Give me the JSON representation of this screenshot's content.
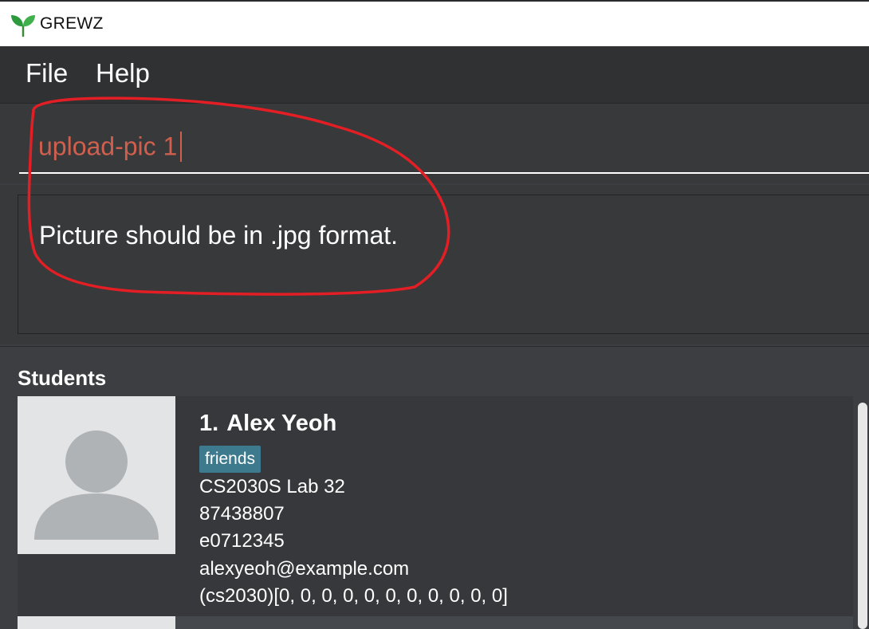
{
  "window": {
    "title": "GREWZ",
    "logo_icon": "sprout-icon"
  },
  "menu": {
    "file": "File",
    "help": "Help"
  },
  "command": {
    "value": "upload-pic 1",
    "text_color": "#d0604d"
  },
  "result": {
    "message": "Picture should be in .jpg format.",
    "annotation_color": "#e31e24"
  },
  "students": {
    "heading": "Students",
    "list": [
      {
        "index": "1.",
        "name": "Alex Yeoh",
        "tag": "friends",
        "lab": "CS2030S Lab 32",
        "phone": "87438807",
        "student_id": "e0712345",
        "email": "alexyeoh@example.com",
        "grades": "(cs2030)[0, 0, 0, 0, 0, 0, 0, 0, 0, 0, 0]"
      }
    ]
  },
  "colors": {
    "tag_bg": "#3d7a8d",
    "background": "#3c3e41"
  }
}
